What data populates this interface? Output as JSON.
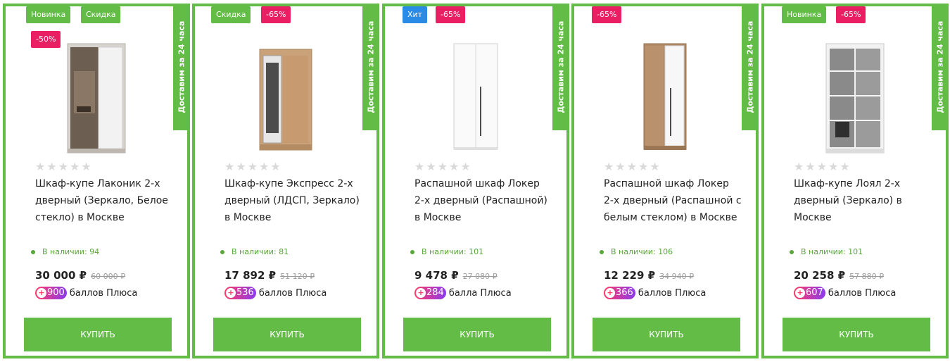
{
  "colors": {
    "green": "#62bc46",
    "pink": "#e91e63",
    "blue": "#2a8be6"
  },
  "delivery_label": "Доставим за 24 часа",
  "buy_label": "КУПИТЬ",
  "products": [
    {
      "badges": [
        {
          "text": "Новинка",
          "color": "green"
        },
        {
          "text": "Скидка",
          "color": "green"
        },
        {
          "text": "-50%",
          "color": "pink"
        }
      ],
      "image": "wardrobe-sliding-mirror-white-glass",
      "rating": 0,
      "title": "Шкаф-купе Лаконик 2-х дверный (Зеркало, Белое стекло) в Москве",
      "stock": "В наличии: 94",
      "price": "30 000 ₽",
      "old_price": "60 000 ₽",
      "points": "900",
      "points_label": "баллов Плюса"
    },
    {
      "badges": [
        {
          "text": "Скидка",
          "color": "green"
        },
        {
          "text": "-65%",
          "color": "pink"
        }
      ],
      "image": "wardrobe-sliding-wood-mirror",
      "rating": 0,
      "title": "Шкаф-купе Экспресс 2-х дверный (ЛДСП, Зеркало) в Москве",
      "stock": "В наличии: 81",
      "price": "17 892 ₽",
      "old_price": "51 120 ₽",
      "points": "536",
      "points_label": "баллов Плюса"
    },
    {
      "badges": [
        {
          "text": "Хит",
          "color": "blue"
        },
        {
          "text": "-65%",
          "color": "pink"
        }
      ],
      "image": "wardrobe-hinged-white",
      "rating": 0,
      "title": "Распашной шкаф Локер 2-х дверный (Распашной) в Москве",
      "stock": "В наличии: 101",
      "price": "9 478 ₽",
      "old_price": "27 080 ₽",
      "points": "284",
      "points_label": "балла Плюса"
    },
    {
      "badges": [
        {
          "text": "-65%",
          "color": "pink"
        }
      ],
      "image": "wardrobe-hinged-wood-white-glass",
      "rating": 0,
      "title": "Распашной шкаф Локер 2-х дверный (Распашной с белым стеклом) в Москве",
      "stock": "В наличии: 106",
      "price": "12 229 ₽",
      "old_price": "34 940 ₽",
      "points": "366",
      "points_label": "баллов Плюса"
    },
    {
      "badges": [
        {
          "text": "Новинка",
          "color": "green"
        },
        {
          "text": "-65%",
          "color": "pink"
        }
      ],
      "image": "wardrobe-sliding-mirror-grid",
      "rating": 0,
      "title": "Шкаф-купе Лоял 2-х дверный (Зеркало) в Москве",
      "stock": "В наличии: 101",
      "price": "20 258 ₽",
      "old_price": "57 880 ₽",
      "points": "607",
      "points_label": "баллов Плюса"
    }
  ]
}
